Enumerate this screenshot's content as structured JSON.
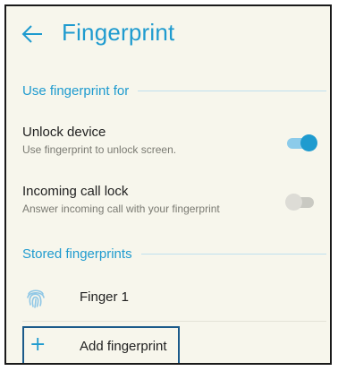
{
  "app_bar": {
    "title": "Fingerprint",
    "back_icon": "arrow-left-icon"
  },
  "sections": {
    "use_for": {
      "header": "Use fingerprint for",
      "items": [
        {
          "title": "Unlock device",
          "subtitle": "Use fingerprint to unlock screen.",
          "enabled": true
        },
        {
          "title": "Incoming call lock",
          "subtitle": "Answer incoming call with your fingerprint",
          "enabled": false
        }
      ]
    },
    "stored": {
      "header": "Stored fingerprints",
      "fingerprints": [
        {
          "label": "Finger 1",
          "icon": "fingerprint-icon"
        }
      ],
      "add_label": "Add fingerprint",
      "add_icon": "plus-icon"
    }
  },
  "colors": {
    "accent": "#1f9bcf",
    "background": "#f7f6ec",
    "text_primary": "#212121",
    "text_secondary": "#7a7a72",
    "focus_outline": "#1b5a8a"
  }
}
